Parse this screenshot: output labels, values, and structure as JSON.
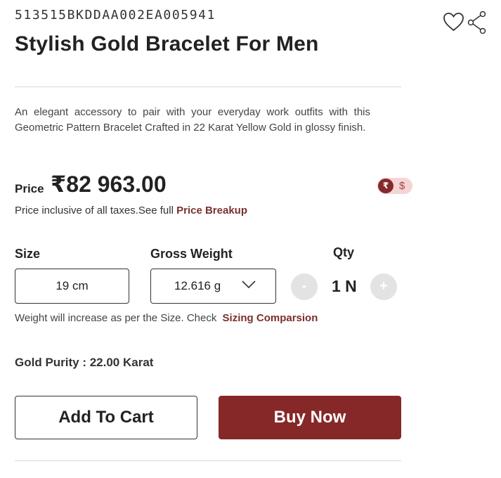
{
  "product": {
    "sku": "513515BKDDAA002EA005941",
    "title": "Stylish Gold Bracelet For Men",
    "description": "An elegant accessory to pair with your everyday work outfits with this Geometric Pattern Bracelet Crafted in 22 Karat Yellow Gold in glossy finish."
  },
  "actions": {
    "wishlist_icon": "heart-icon",
    "share_icon": "share-icon"
  },
  "price": {
    "label": "Price",
    "value": "₹82 963.00",
    "tax_note": "Price inclusive of all taxes.See full ",
    "breakup_link": "Price Breakup"
  },
  "currency_toggle": {
    "active": "₹",
    "inactive": "$",
    "active_color": "#842a2a",
    "track_color": "#f6d4d4"
  },
  "options": {
    "size_label": "Size",
    "size_value": "19 cm",
    "weight_label": "Gross Weight",
    "weight_value": "12.616 g",
    "qty_label": "Qty",
    "qty_minus": "-",
    "qty_value": "1 N",
    "qty_plus": "+"
  },
  "size_note": {
    "text": "Weight will increase as per the Size. Check ",
    "link": "Sizing Comparsion"
  },
  "purity": "Gold Purity : 22.00 Karat",
  "buttons": {
    "add_to_cart": "Add To Cart",
    "buy_now": "Buy Now"
  },
  "colors": {
    "brand": "#862828",
    "link": "#7a2f2f"
  }
}
